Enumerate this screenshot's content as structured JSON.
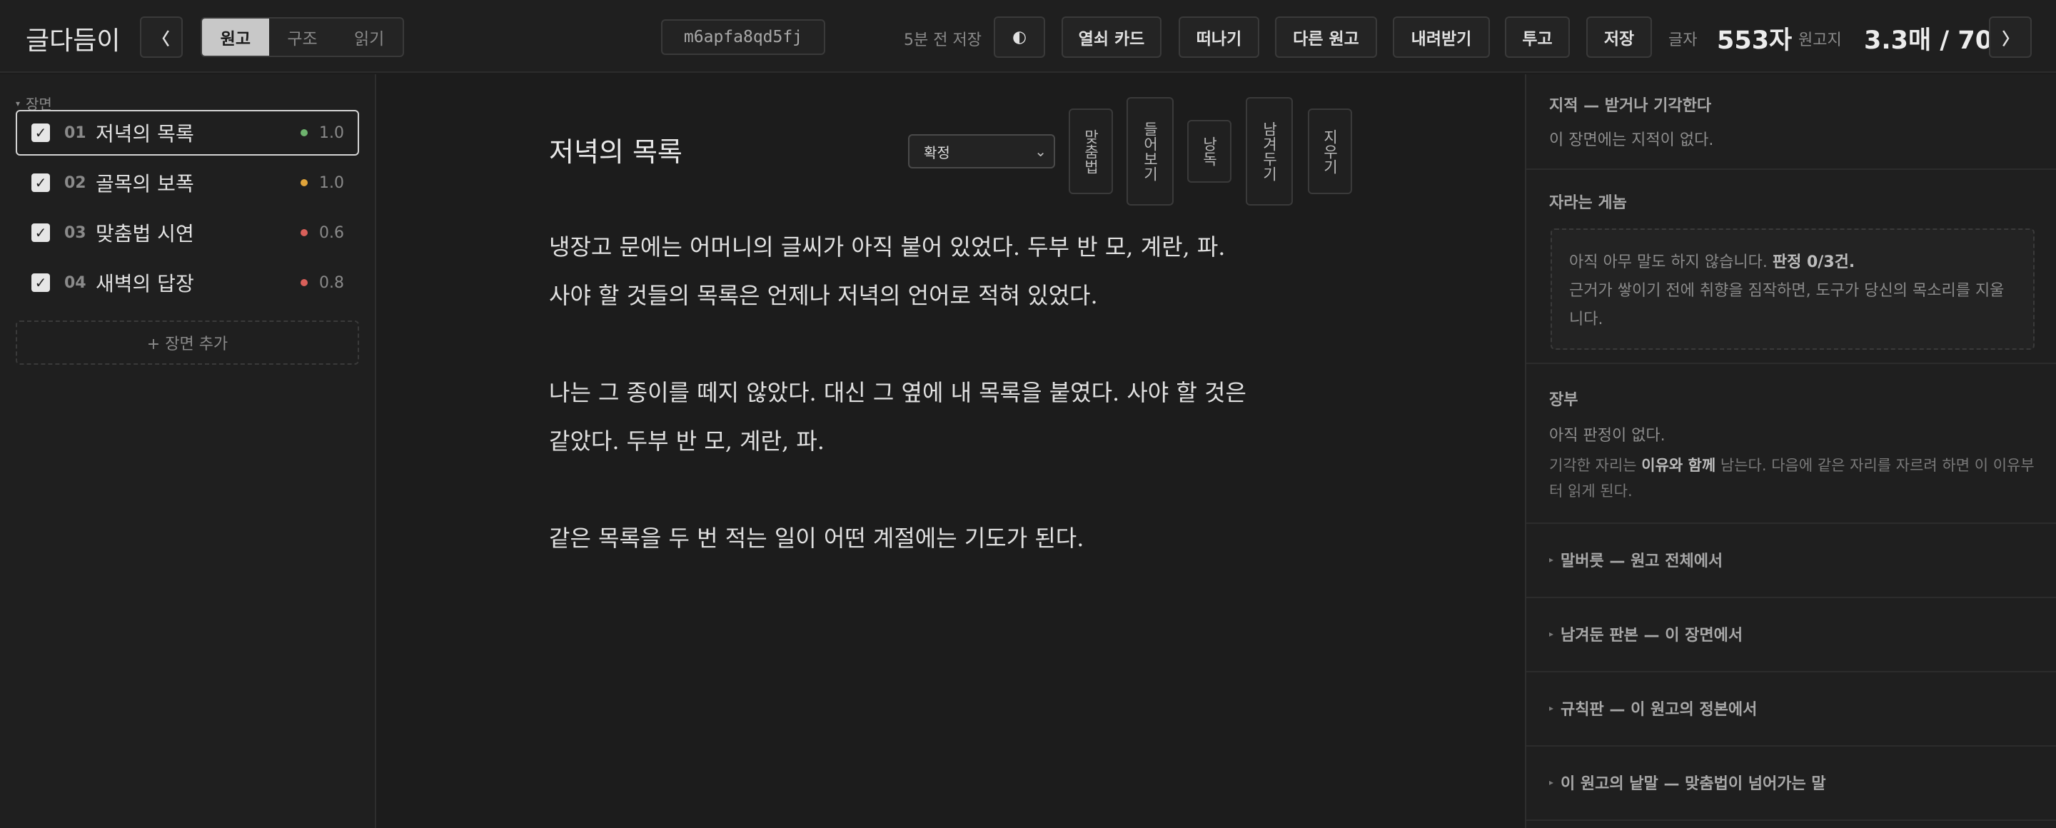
{
  "app": {
    "title": "글다듬이"
  },
  "topbar": {
    "prev_label": "〈",
    "next_label": "〉",
    "modes": [
      "원고",
      "구조",
      "읽기"
    ],
    "active_mode": "원고",
    "doc_id": "m6apfa8qd5fj",
    "saved_text": "5분 전 저장",
    "theme_icon": "◐",
    "buttons": {
      "key_card": "열쇠 카드",
      "leave": "떠나기",
      "other_draft": "다른 원고",
      "download": "내려받기",
      "submit": "투고",
      "save": "저장"
    },
    "stats": {
      "chars_label": "글자",
      "chars_value": "553자",
      "manuscript_label": "원고지",
      "manuscript_value": "3.3매 / 70"
    }
  },
  "sidebar": {
    "heading": "장면",
    "caret": "▾",
    "scenes": [
      {
        "num": "01",
        "title": "저녁의 목록",
        "score": "1.0",
        "dot_color": "#6db36d",
        "checked": true
      },
      {
        "num": "02",
        "title": "골목의 보폭",
        "score": "1.0",
        "dot_color": "#e0a43a",
        "checked": true
      },
      {
        "num": "03",
        "title": "맞춤법 시연",
        "score": "0.6",
        "dot_color": "#d9605a",
        "checked": true
      },
      {
        "num": "04",
        "title": "새벽의 답장",
        "score": "0.8",
        "dot_color": "#d9605a",
        "checked": true
      }
    ],
    "check_glyph": "✓",
    "add_scene": "+ 장면 추가"
  },
  "editor": {
    "scene_title": "저녁의 목록",
    "status": "확정",
    "status_chevron": "⌄",
    "tools": [
      "맞춤법",
      "들어보기",
      "낭독",
      "남겨두기",
      "지우기"
    ],
    "paragraphs": [
      [
        "냉장고 문에는 어머니의 글씨가 아직 붙어 있었다. 두부 반 모, 계란, 파.",
        "사야 할 것들의 목록은 언제나 저녁의 언어로 적혀 있었다."
      ],
      [
        "나는 그 종이를 떼지 않았다. 대신 그 옆에 내 목록을 붙였다. 사야 할 것은",
        "같았다. 두부 반 모, 계란, 파."
      ],
      [
        "같은 목록을 두 번 적는 일이 어떤 계절에는 기도가 된다."
      ]
    ]
  },
  "rpanel": {
    "point": {
      "title": "지적 — 받거나 기각한다",
      "text": "이 장면에는 지적이 없다."
    },
    "critic": {
      "title": "자라는 게놈",
      "line1": "아직 아무 말도 하지 않습니다. ",
      "line1_bold": "판정 0/3건.",
      "line2": "근거가 쌓이기 전에 취향을 짐작하면, 도구가 당신의 목소리를 지울",
      "line3": "니다."
    },
    "ledger": {
      "title": "장부",
      "text": "아직 판정이 없다.",
      "note_pre": "기각한 자리는 ",
      "note_bold": "이유와 함께",
      "note_post": " 남는다. 다음에 같은 자리를 자르려 하면 이 이유부",
      "note_line2": "터 읽게 된다."
    },
    "collapsibles": [
      "말버릇 — 원고 전체에서",
      "남겨둔 판본 — 이 장면에서",
      "규칙판 — 이 원고의 정본에서",
      "이 원고의 낱말 — 맞춤법이 넘어가는 말"
    ],
    "tri": "▸"
  }
}
